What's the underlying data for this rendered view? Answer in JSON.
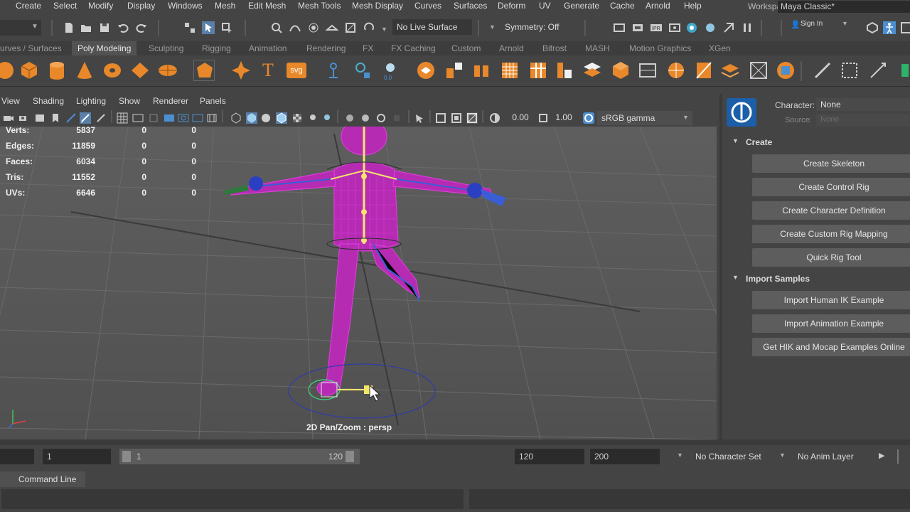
{
  "menubar": {
    "items": [
      "Create",
      "Select",
      "Modify",
      "Display",
      "Windows",
      "Mesh",
      "Edit Mesh",
      "Mesh Tools",
      "Mesh Display",
      "Curves",
      "Surfaces",
      "Deform",
      "UV",
      "Generate",
      "Cache",
      "Arnold",
      "Help"
    ],
    "workspace_label": "Workspace :",
    "workspace_value": "Maya Classic*"
  },
  "statusline": {
    "live_surface": "No Live Surface",
    "symmetry": "Symmetry: Off",
    "sign_in": "Sign In"
  },
  "shelf": {
    "tabs": [
      "urves / Surfaces",
      "Poly Modeling",
      "Sculpting",
      "Rigging",
      "Animation",
      "Rendering",
      "FX",
      "FX Caching",
      "Custom",
      "Arnold",
      "Bifrost",
      "MASH",
      "Motion Graphics",
      "XGen"
    ],
    "active_tab": "Poly Modeling",
    "text_icon": "T",
    "svg_icon": "svg"
  },
  "viewport": {
    "menus": [
      "View",
      "Shading",
      "Lighting",
      "Show",
      "Renderer",
      "Panels"
    ],
    "exposure": "0.00",
    "gamma": "1.00",
    "color_space": "sRGB gamma",
    "hud": [
      {
        "label": "Verts:",
        "values": [
          "5837",
          "0",
          "0"
        ]
      },
      {
        "label": "Edges:",
        "values": [
          "11859",
          "0",
          "0"
        ]
      },
      {
        "label": "Faces:",
        "values": [
          "6034",
          "0",
          "0"
        ]
      },
      {
        "label": "Tris:",
        "values": [
          "11552",
          "0",
          "0"
        ]
      },
      {
        "label": "UVs:",
        "values": [
          "6646",
          "0",
          "0"
        ]
      }
    ],
    "camera_label": "2D Pan/Zoom : persp"
  },
  "hik": {
    "character_label": "Character:",
    "character_value": "None",
    "source_label": "Source:",
    "source_value": "None",
    "sections": [
      {
        "title": "Create",
        "buttons": [
          "Create Skeleton",
          "Create Control Rig",
          "Create Character Definition",
          "Create Custom Rig Mapping",
          "Quick Rig Tool"
        ]
      },
      {
        "title": "Import Samples",
        "buttons": [
          "Import Human IK Example",
          "Import Animation Example",
          "Get HIK and Mocap Examples Online"
        ]
      }
    ]
  },
  "range": {
    "start": "1",
    "slider_start": "1",
    "slider_end": "120",
    "end": "120",
    "anim_end": "200",
    "character_set": "No Character Set",
    "anim_layer": "No Anim Layer"
  },
  "command": {
    "tab_label": "Command Line"
  },
  "colors": {
    "accent_blue": "#4b8fd0",
    "shelf_orange": "#e8882a",
    "wire_magenta": "#d829d8"
  }
}
